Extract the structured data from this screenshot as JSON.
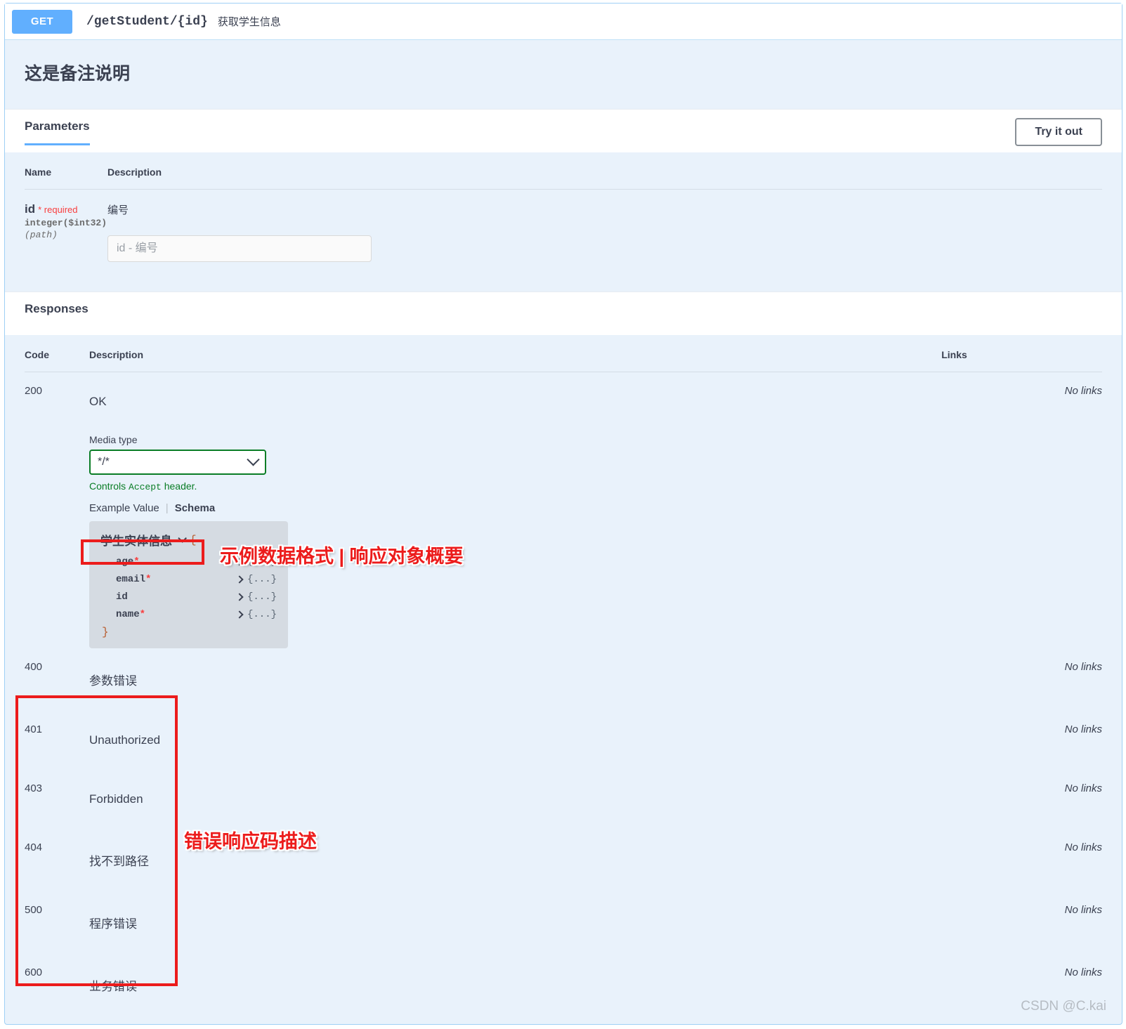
{
  "operation": {
    "method": "GET",
    "path": "/getStudent/{id}",
    "summary": "获取学生信息",
    "notes_title": "这是备注说明",
    "method_color": "#61affe"
  },
  "parameters_section": {
    "tab_label": "Parameters",
    "try_it_out_label": "Try it out",
    "columns": {
      "name": "Name",
      "description": "Description"
    },
    "rows": [
      {
        "name": "id",
        "required_label": "* required",
        "type": "integer($int32)",
        "in": "(path)",
        "description": "编号",
        "input_placeholder": "id - 编号",
        "input_value": ""
      }
    ]
  },
  "responses_section": {
    "heading": "Responses",
    "columns": {
      "code": "Code",
      "description": "Description",
      "links": "Links"
    },
    "no_links_label": "No links",
    "rows": [
      {
        "code": "200",
        "description": "OK"
      },
      {
        "code": "400",
        "description": "参数错误"
      },
      {
        "code": "401",
        "description": "Unauthorized"
      },
      {
        "code": "403",
        "description": "Forbidden"
      },
      {
        "code": "404",
        "description": "找不到路径"
      },
      {
        "code": "500",
        "description": "程序错误"
      },
      {
        "code": "600",
        "description": "业务错误"
      }
    ]
  },
  "media": {
    "label": "Media type",
    "selected": "*/*",
    "options": [
      "*/*"
    ],
    "hint_prefix": "Controls ",
    "hint_code": "Accept",
    "hint_suffix": " header.",
    "border_color": "#0a7d26"
  },
  "example_tabs": {
    "example_value": "Example Value",
    "separator": "|",
    "schema": "Schema",
    "active": "Schema"
  },
  "model": {
    "title": "学生实体信息",
    "open_brace": "{",
    "close_brace": "}",
    "collapsed_marker": "{...}",
    "properties": [
      {
        "name": "age",
        "required": true
      },
      {
        "name": "email",
        "required": true
      },
      {
        "name": "id",
        "required": false
      },
      {
        "name": "name",
        "required": true
      }
    ]
  },
  "annotations": {
    "color": "#ec1c1c",
    "example_note": "示例数据格式 | 响应对象概要",
    "error_codes_note": "错误响应码描述"
  },
  "watermark": "CSDN @C.kai"
}
